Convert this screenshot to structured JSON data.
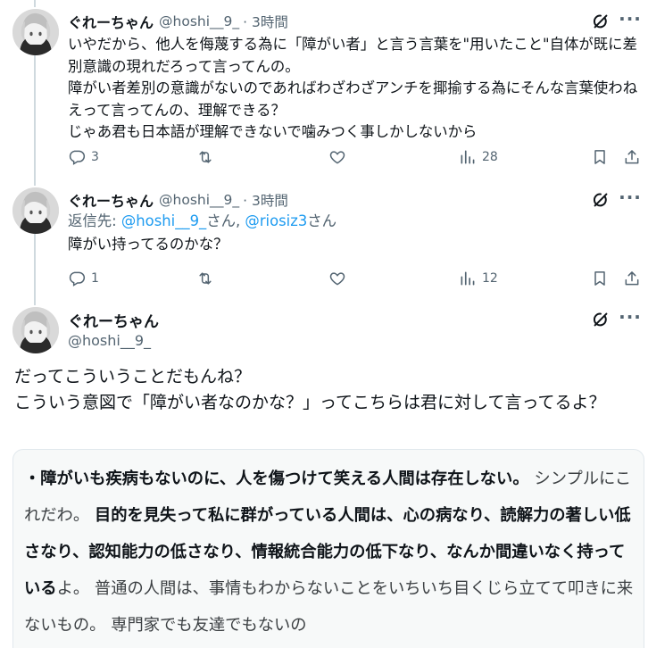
{
  "tweets": [
    {
      "name": "ぐれーちゃん",
      "handle": "@hoshi__9_",
      "time": "· 3時間",
      "text": "いやだから、他人を侮蔑する為に「障がい者」と言う言葉を\"用いたこと\"自体が既に差別意識の現れだろって言ってんの。\n障がい者差別の意識がないのであればわざわざアンチを揶揄する為にそんな言葉使わねえって言ってんの、理解できる？\nじゃあ君も日本語が理解できないで噛みつく事しかしないから",
      "replies": "3",
      "retweets": "",
      "likes": "",
      "views": "28"
    },
    {
      "name": "ぐれーちゃん",
      "handle": "@hoshi__9_",
      "time": "· 3時間",
      "reply_prefix": "返信先: ",
      "mention1": "@hoshi__9_",
      "reply_mid": "さん, ",
      "mention2": "@riosiz3",
      "reply_suffix": "さん",
      "text": "障がい持ってるのかな？",
      "replies": "1",
      "retweets": "",
      "likes": "",
      "views": "12"
    }
  ],
  "main_tweet": {
    "name": "ぐれーちゃん",
    "handle": "@hoshi__9_",
    "text": "だってこういうことだもんね？\nこういう意図で「障がい者なのかな？」ってこちらは君に対して言ってるよ？"
  },
  "quote": {
    "p1": "・障がいも疾病もないのに、人を傷つけて笑える人間は存在しない。",
    "p2": " シンプルにこれだわ。",
    "p3": "目的を見失って私に群がっている人間は、心の病なり、読解力の著しい低さなり、認知能力の低さなり、情報統合能力の低下なり、なんか間違いなく持っている",
    "p4": "よ。 普通の人間は、事情もわからないことをいちいち目くじら立てて叩きに来ないもの。 専門家でも友達でもないの"
  },
  "icons": {
    "reply": "reply-icon",
    "retweet": "retweet-icon",
    "like": "like-icon",
    "views": "views-icon",
    "bookmark": "bookmark-icon",
    "share": "share-icon",
    "grok": "grok-icon",
    "more": "more-icon"
  },
  "colors": {
    "text": "#0f1419",
    "secondary": "#536471",
    "link": "#1d9bf0",
    "thread_line": "#cfd9de",
    "quote_bg": "#f7f9f9"
  }
}
